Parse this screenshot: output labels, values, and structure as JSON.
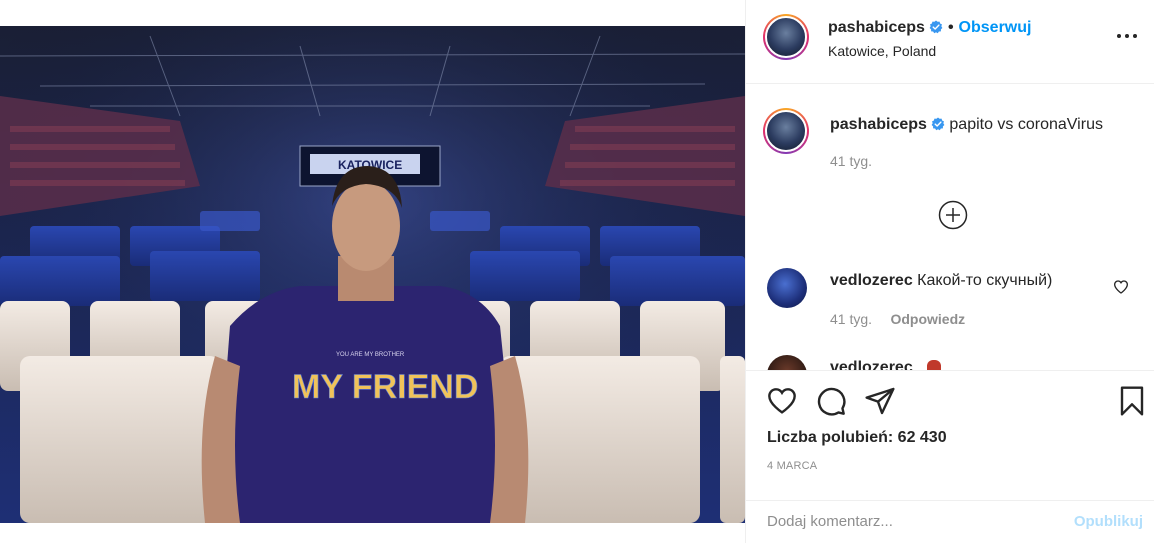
{
  "post": {
    "photo_shirt_text": "MY FRIEND",
    "photo_shirt_small_text": "YOU ARE MY BROTHER",
    "photo_banner_text": "KATOWICE"
  },
  "header": {
    "username": "pashabiceps",
    "separator": "•",
    "follow_label": "Obserwuj",
    "location": "Katowice, Poland"
  },
  "caption": {
    "username": "pashabiceps",
    "text": "papito vs coronaVirus",
    "time": "41 tyg."
  },
  "comments": [
    {
      "username": "vedlozerec",
      "text": "Какой-то скучный)",
      "time": "41 tyg.",
      "reply_label": "Odpowiedz"
    }
  ],
  "partial_comment_hint": "vedlozerec",
  "actions": {
    "likes_label": "Liczba polubień: 62 430",
    "date": "4 MARCA"
  },
  "add_comment": {
    "placeholder": "Dodaj komentarz...",
    "publish_label": "Opublikuj"
  },
  "colors": {
    "accent": "#0095f6",
    "verified": "#3897f0",
    "publish_disabled": "#b2dffc",
    "muted": "#8e8e8e"
  },
  "icons": [
    "verified-icon",
    "more-options-icon",
    "load-more-icon",
    "heart-icon",
    "comment-icon",
    "share-icon",
    "bookmark-icon"
  ]
}
